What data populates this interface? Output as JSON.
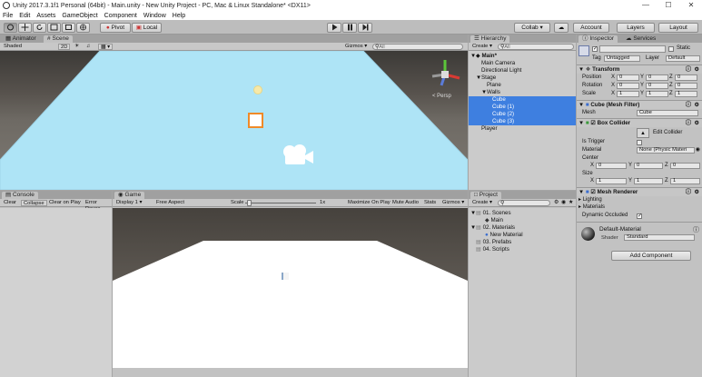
{
  "window": {
    "title": "Unity 2017.3.1f1 Personal (64bit) - Main.unity - New Unity Project - PC, Mac & Linux Standalone* <DX11>",
    "minimize": "—",
    "maximize": "☐",
    "close": "✕"
  },
  "menu": [
    "File",
    "Edit",
    "Assets",
    "GameObject",
    "Component",
    "Window",
    "Help"
  ],
  "toolbar": {
    "pivot": "Pivot",
    "local": "Local",
    "collab": "Collab ▾",
    "account": "Account",
    "layers": "Layers",
    "layout": "Layout"
  },
  "scene_panel": {
    "tabs": [
      "Animator",
      "Scene"
    ],
    "shading": "Shaded",
    "mode2d": "2D",
    "gizmos": "Gizmos ▾",
    "search": "All",
    "persp": "< Persp"
  },
  "hierarchy": {
    "tab": "Hierarchy",
    "create": "Create ▾",
    "search": "All",
    "items": [
      {
        "label": "Main*",
        "indent": 0,
        "bold": true,
        "selected": false,
        "arrow": "▼"
      },
      {
        "label": "Main Camera",
        "indent": 1,
        "selected": false,
        "arrow": ""
      },
      {
        "label": "Directional Light",
        "indent": 1,
        "selected": false,
        "arrow": ""
      },
      {
        "label": "Stage",
        "indent": 1,
        "selected": false,
        "arrow": "▼"
      },
      {
        "label": "Plane",
        "indent": 2,
        "selected": false,
        "arrow": ""
      },
      {
        "label": "Walls",
        "indent": 2,
        "selected": false,
        "arrow": "▼"
      },
      {
        "label": "Cube",
        "indent": 3,
        "selected": true,
        "arrow": ""
      },
      {
        "label": "Cube (1)",
        "indent": 3,
        "selected": true,
        "arrow": ""
      },
      {
        "label": "Cube (2)",
        "indent": 3,
        "selected": true,
        "arrow": ""
      },
      {
        "label": "Cube (3)",
        "indent": 3,
        "selected": true,
        "arrow": ""
      },
      {
        "label": "Player",
        "indent": 1,
        "selected": false,
        "arrow": ""
      }
    ]
  },
  "inspector": {
    "tabs": [
      "Inspector",
      "Services"
    ],
    "static": "Static",
    "tag_label": "Tag",
    "tag_value": "Untagged",
    "layer_label": "Layer",
    "layer_value": "Default",
    "transform": {
      "title": "Transform",
      "rows": [
        {
          "label": "Position",
          "x": "0",
          "y": "0",
          "z": "0"
        },
        {
          "label": "Rotation",
          "x": "0",
          "y": "0",
          "z": "0"
        },
        {
          "label": "Scale",
          "x": "1",
          "y": "1",
          "z": "1"
        }
      ]
    },
    "mesh_filter": {
      "title": "Cube (Mesh Filter)",
      "mesh_label": "Mesh",
      "mesh_value": "Cube"
    },
    "box_collider": {
      "title": "Box Collider",
      "edit_collider": "Edit Collider",
      "is_trigger": "Is Trigger",
      "material": "Material",
      "material_value": "None (Physic Materi",
      "center": "Center",
      "center_vals": {
        "x": "0",
        "y": "0",
        "z": "0"
      },
      "size": "Size",
      "size_vals": {
        "x": "1",
        "y": "1",
        "z": "1"
      }
    },
    "mesh_renderer": {
      "title": "Mesh Renderer",
      "lighting": "Lighting",
      "materials": "Materials",
      "dynamic_occluded": "Dynamic Occluded"
    },
    "material": {
      "name": "Default-Material",
      "shader_label": "Shader",
      "shader_value": "Standard"
    },
    "add_component": "Add Component"
  },
  "console": {
    "tab": "Console",
    "buttons": [
      "Clear",
      "Collapse",
      "Clear on Play",
      "Error Pause"
    ]
  },
  "game": {
    "tab": "Game",
    "display": "Display 1 ▾",
    "aspect": "Free Aspect",
    "scale_label": "Scale",
    "scale_value": "1x",
    "maximize": "Maximize On Play",
    "mute": "Mute Audio",
    "stats": "Stats",
    "gizmos": "Gizmos ▾"
  },
  "project": {
    "tab": "Project",
    "create": "Create ▾",
    "items": [
      {
        "label": "01. Scenes",
        "indent": 0,
        "arrow": "▼",
        "type": "folder"
      },
      {
        "label": "Main",
        "indent": 1,
        "arrow": "",
        "type": "scene"
      },
      {
        "label": "02. Materials",
        "indent": 0,
        "arrow": "▼",
        "type": "folder"
      },
      {
        "label": "New Material",
        "indent": 1,
        "arrow": "",
        "type": "material"
      },
      {
        "label": "03. Prefabs",
        "indent": 0,
        "arrow": "",
        "type": "folder"
      },
      {
        "label": "04. Scripts",
        "indent": 0,
        "arrow": "",
        "type": "folder"
      }
    ]
  },
  "colors": {
    "selection": "#3e7fe0",
    "scene_floor": "#aee4f6",
    "selected_outline": "#f08a28"
  }
}
